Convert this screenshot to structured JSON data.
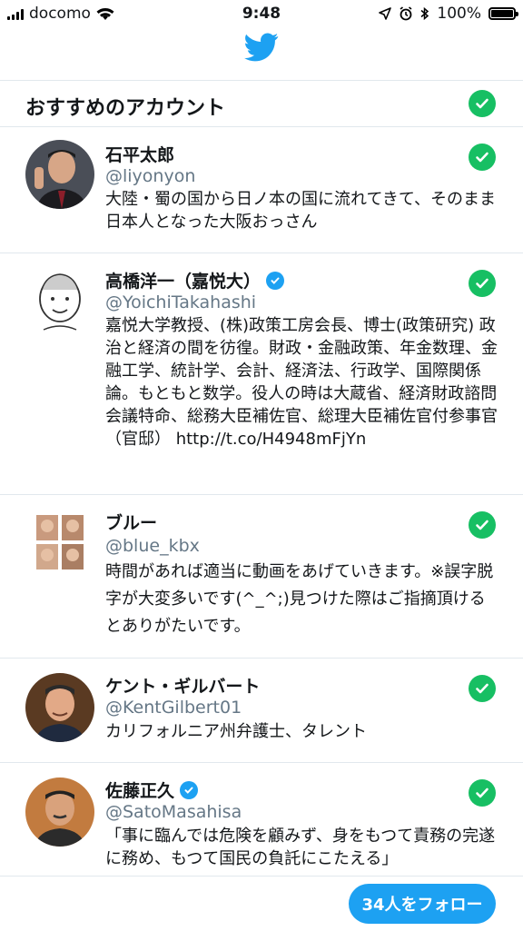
{
  "status_bar": {
    "carrier": "docomo",
    "time": "9:48",
    "battery": "100%"
  },
  "header": {
    "title": "おすすめのアカウント"
  },
  "accounts": [
    {
      "name": "石平太郎",
      "handle": "@liyonyon",
      "verified": false,
      "bio": "大陸・蜀の国から日ノ本の国に流れてきて、そのまま日本人となった大阪おっさん"
    },
    {
      "name": "高橋洋一（嘉悦大）",
      "handle": "@YoichiTakahashi",
      "verified": true,
      "bio": "嘉悦大学教授、(株)政策工房会長、博士(政策研究) 政治と経済の間を彷徨。財政・金融政策、年金数理、金融工学、統計学、会計、経済法、行政学、国際関係論。もともと数学。役人の時は大蔵省、経済財政諮問会議特命、総務大臣補佐官、総理大臣補佐官付参事官（官邸） http://t.co/H4948mFjYn"
    },
    {
      "name": "ブルー",
      "handle": "@blue_kbx",
      "verified": false,
      "bio": "時間があれば適当に動画をあげていきます。※誤字脱字が大変多いです(^_^;)見つけた際はご指摘頂けるとありがたいです。"
    },
    {
      "name": "ケント・ギルバート",
      "handle": "@KentGilbert01",
      "verified": false,
      "bio": "カリフォルニア州弁護士、タレント"
    },
    {
      "name": "佐藤正久",
      "handle": "@SatoMasahisa",
      "verified": true,
      "bio": "「事に臨んでは危険を顧みず、身をもつて責務の完遂に務め、もつて国民の負託にこたえる」"
    }
  ],
  "footer": {
    "follow_label": "34人をフォロー"
  },
  "colors": {
    "accent": "#1da1f2",
    "check": "#17bf63"
  }
}
